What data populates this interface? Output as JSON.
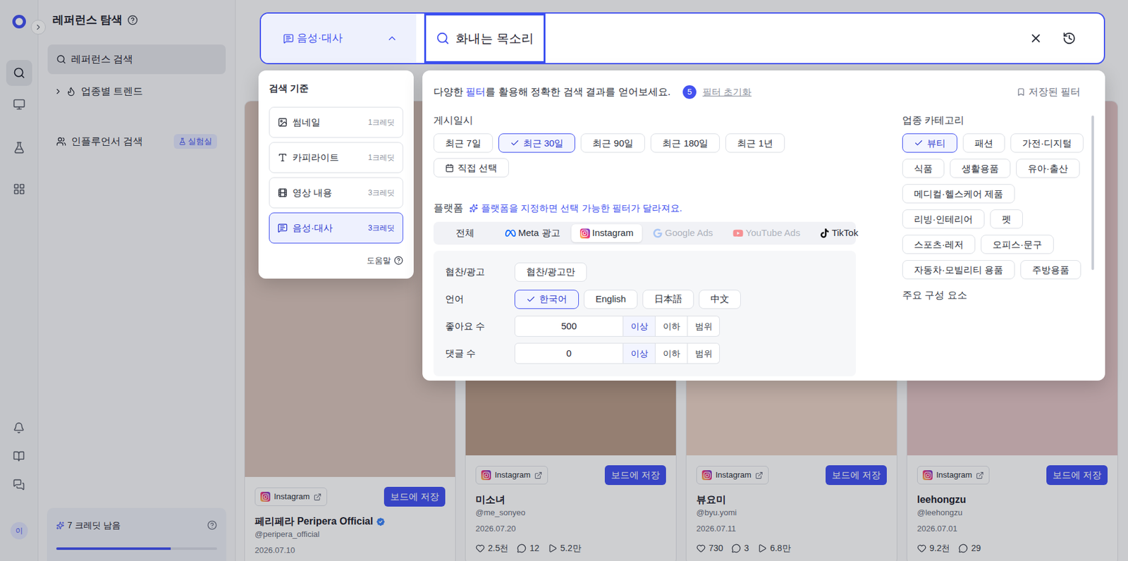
{
  "rail": {
    "items": [
      {
        "selected": true
      },
      {
        "selected": false
      },
      {
        "selected": false
      },
      {
        "selected": false
      }
    ],
    "avatar": "이"
  },
  "sidebar": {
    "title": "레퍼런스 탐색",
    "items": [
      {
        "label": "레퍼런스 검색",
        "selected": true,
        "expandable": false,
        "badge": ""
      },
      {
        "label": "업종별 트렌드",
        "selected": false,
        "expandable": true,
        "badge": ""
      },
      {
        "label": "인플루언서 검색",
        "selected": false,
        "expandable": false,
        "badge": "실험실"
      }
    ],
    "credits": {
      "label": "7 크레딧 남음",
      "level": 0.71
    }
  },
  "search": {
    "mode": "음성·대사",
    "mode_open": true,
    "query": "화내는 목소리",
    "focused": true
  },
  "mode_menu": {
    "title": "검색 기준",
    "options": [
      {
        "label": "썸네일",
        "cost": "1크레딧",
        "selected": false
      },
      {
        "label": "카피라이트",
        "cost": "1크레딧",
        "selected": false
      },
      {
        "label": "영상 내용",
        "cost": "3크레딧",
        "selected": false
      },
      {
        "label": "음성·대사",
        "cost": "3크레딧",
        "selected": true
      }
    ],
    "help": "도움말"
  },
  "filters": {
    "intro_pre": "다양한 ",
    "intro_link": "필터",
    "intro_post": "를 활용해 정확한 검색 결과를 얻어보세요.",
    "count": "5",
    "reset": "필터 초기화",
    "saved": "저장된 필터",
    "date": {
      "label": "게시일시",
      "options": [
        {
          "label": "최근 7일",
          "selected": false,
          "kind": "preset"
        },
        {
          "label": "최근 30일",
          "selected": true,
          "kind": "preset"
        },
        {
          "label": "최근 90일",
          "selected": false,
          "kind": "preset"
        },
        {
          "label": "최근 180일",
          "selected": false,
          "kind": "preset"
        },
        {
          "label": "최근 1년",
          "selected": false,
          "kind": "preset"
        },
        {
          "label": "직접 선택",
          "selected": false,
          "kind": "custom"
        }
      ]
    },
    "platform": {
      "label": "플랫폼",
      "hint": "플랫폼을 지정하면 선택 가능한 필터가 달라져요.",
      "tabs": [
        {
          "label": "전체",
          "selected": false,
          "disabled": false
        },
        {
          "label": "Meta 광고",
          "selected": false,
          "disabled": false
        },
        {
          "label": "Instagram",
          "selected": true,
          "disabled": false
        },
        {
          "label": "Google Ads",
          "selected": false,
          "disabled": true
        },
        {
          "label": "YouTube Ads",
          "selected": false,
          "disabled": true
        },
        {
          "label": "TikTok",
          "selected": false,
          "disabled": false
        }
      ]
    },
    "rows": [
      {
        "kind": "chips",
        "label": "협찬/광고",
        "options": [
          {
            "label": "협찬/광고만",
            "selected": false
          }
        ]
      },
      {
        "kind": "chips",
        "label": "언어",
        "options": [
          {
            "label": "한국어",
            "selected": true
          },
          {
            "label": "English",
            "selected": false
          },
          {
            "label": "日本語",
            "selected": false
          },
          {
            "label": "中文",
            "selected": false
          }
        ]
      },
      {
        "kind": "number",
        "label": "좋아요 수",
        "value": "500",
        "modes": [
          {
            "label": "이상",
            "selected": true
          },
          {
            "label": "이하",
            "selected": false
          },
          {
            "label": "범위",
            "selected": false
          }
        ]
      },
      {
        "kind": "number",
        "label": "댓글 수",
        "value": "0",
        "modes": [
          {
            "label": "이상",
            "selected": true
          },
          {
            "label": "이하",
            "selected": false
          },
          {
            "label": "범위",
            "selected": false
          }
        ]
      }
    ],
    "category": {
      "label": "업종 카테고리",
      "options": [
        {
          "label": "뷰티",
          "selected": true
        },
        {
          "label": "패션",
          "selected": false
        },
        {
          "label": "가전·디지털",
          "selected": false
        },
        {
          "label": "식품",
          "selected": false
        },
        {
          "label": "생활용품",
          "selected": false
        },
        {
          "label": "유아·출산",
          "selected": false
        },
        {
          "label": "메디컬·헬스케어 제품",
          "selected": false
        },
        {
          "label": "리빙·인테리어",
          "selected": false
        },
        {
          "label": "펫",
          "selected": false
        },
        {
          "label": "스포츠·레저",
          "selected": false
        },
        {
          "label": "오피스·문구",
          "selected": false
        },
        {
          "label": "자동차·모빌리티 용품",
          "selected": false
        },
        {
          "label": "주방용품",
          "selected": false
        }
      ]
    },
    "next_section": "주요 구성 요소"
  },
  "cards": [
    {
      "platform": "Instagram",
      "save": "보드에 저장",
      "name": "페리페라 Peripera Official",
      "verified": true,
      "handle": "@peripera_official",
      "date": "2026.07.10",
      "stats": []
    },
    {
      "platform": "Instagram",
      "save": "보드에 저장",
      "name": "미소녀",
      "verified": false,
      "handle": "@me_sonyeo",
      "date": "2026.07.20",
      "stats": [
        {
          "kind": "likes",
          "value": "2.5천"
        },
        {
          "kind": "comments",
          "value": "12"
        },
        {
          "kind": "plays",
          "value": "5.2만"
        }
      ]
    },
    {
      "platform": "Instagram",
      "save": "보드에 저장",
      "name": "뷰요미",
      "verified": false,
      "handle": "@byu.yomi",
      "date": "2026.07.11",
      "stats": [
        {
          "kind": "likes",
          "value": "730"
        },
        {
          "kind": "comments",
          "value": "3"
        },
        {
          "kind": "plays",
          "value": "6.8만"
        }
      ]
    },
    {
      "platform": "Instagram",
      "save": "보드에 저장",
      "name": "leehongzu",
      "verified": false,
      "handle": "@leehongzu",
      "date": "2026.07.01",
      "stats": [
        {
          "kind": "likes",
          "value": "9.2천"
        },
        {
          "kind": "comments",
          "value": "29"
        }
      ]
    }
  ]
}
